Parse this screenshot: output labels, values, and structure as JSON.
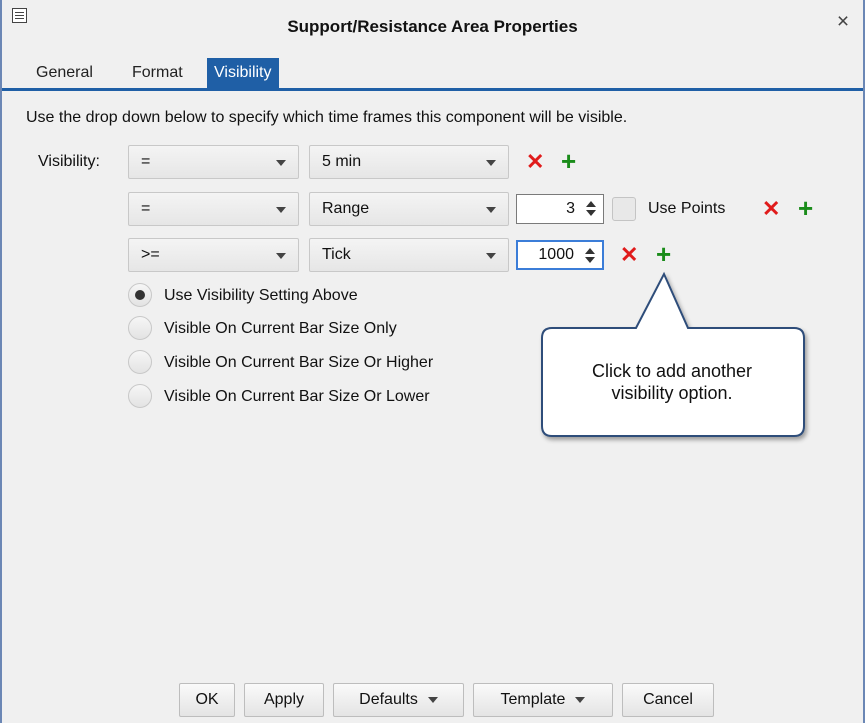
{
  "window": {
    "title": "Support/Resistance Area Properties",
    "close_glyph": "×"
  },
  "tabs": [
    {
      "label": "General",
      "active": false
    },
    {
      "label": "Format",
      "active": false
    },
    {
      "label": "Visibility",
      "active": true
    }
  ],
  "visibility": {
    "instructions": "Use the drop down below to specify which time frames this component will be visible.",
    "label": "Visibility:",
    "rows": [
      {
        "operator": "=",
        "timeframe": "5 min"
      },
      {
        "operator": "=",
        "timeframe": "Range",
        "value": "3",
        "use_points_label": "Use Points"
      },
      {
        "operator": ">=",
        "timeframe": "Tick",
        "value": "1000"
      }
    ],
    "remove_glyph": "✕",
    "add_glyph": "+",
    "options": [
      {
        "label": "Use Visibility Setting Above",
        "selected": true
      },
      {
        "label": "Visible On Current Bar Size Only",
        "selected": false
      },
      {
        "label": "Visible On Current Bar Size Or Higher",
        "selected": false
      },
      {
        "label": "Visible On Current Bar Size Or Lower",
        "selected": false
      }
    ]
  },
  "callout": {
    "line1": "Click to add another",
    "line2": "visibility option."
  },
  "footer": {
    "ok": "OK",
    "apply": "Apply",
    "defaults": "Defaults",
    "template": "Template",
    "cancel": "Cancel"
  },
  "colors": {
    "accent": "#1f5fa6",
    "remove": "#e01b1b",
    "add": "#1a8c1a"
  }
}
